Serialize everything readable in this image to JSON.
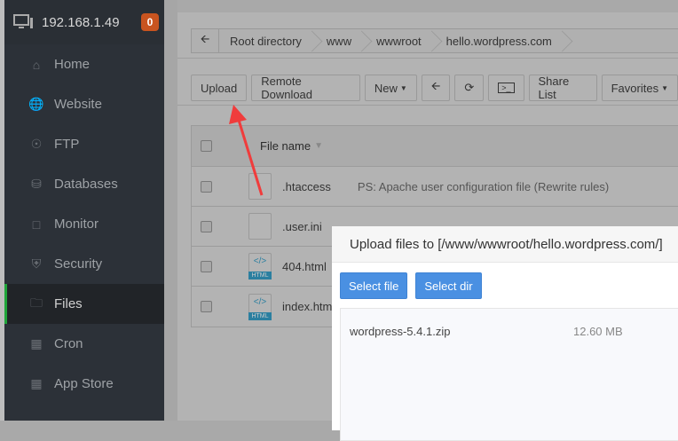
{
  "sidebar": {
    "host": "192.168.1.49",
    "badge": "0",
    "items": [
      {
        "label": "Home",
        "icon": "home-icon"
      },
      {
        "label": "Website",
        "icon": "globe-icon"
      },
      {
        "label": "FTP",
        "icon": "ftp-icon"
      },
      {
        "label": "Databases",
        "icon": "database-icon"
      },
      {
        "label": "Monitor",
        "icon": "monitor-icon"
      },
      {
        "label": "Security",
        "icon": "shield-icon"
      },
      {
        "label": "Files",
        "icon": "folder-icon",
        "active": true
      },
      {
        "label": "Cron",
        "icon": "calendar-icon"
      },
      {
        "label": "App Store",
        "icon": "grid-icon"
      }
    ]
  },
  "breadcrumb": [
    "Root directory",
    "www",
    "wwwroot",
    "hello.wordpress.com"
  ],
  "toolbar": {
    "upload": "Upload",
    "remote": "Remote Download",
    "new": "New",
    "share": "Share List",
    "favorites": "Favorites"
  },
  "table": {
    "header": "File name",
    "rows": [
      {
        "name": ".htaccess",
        "note": "PS: Apache user configuration file (Rewrite rules)",
        "type": "file"
      },
      {
        "name": ".user.ini",
        "note": "",
        "type": "file"
      },
      {
        "name": "404.html",
        "note": "",
        "type": "html"
      },
      {
        "name": "index.html",
        "note": "",
        "type": "html"
      }
    ],
    "html_tag": "HTML"
  },
  "modal": {
    "title": "Upload files to [/www/wwwroot/hello.wordpress.com/]",
    "select_file": "Select file",
    "select_dir": "Select dir",
    "files": [
      {
        "name": "wordpress-5.4.1.zip",
        "size": "12.60 MB"
      }
    ]
  }
}
